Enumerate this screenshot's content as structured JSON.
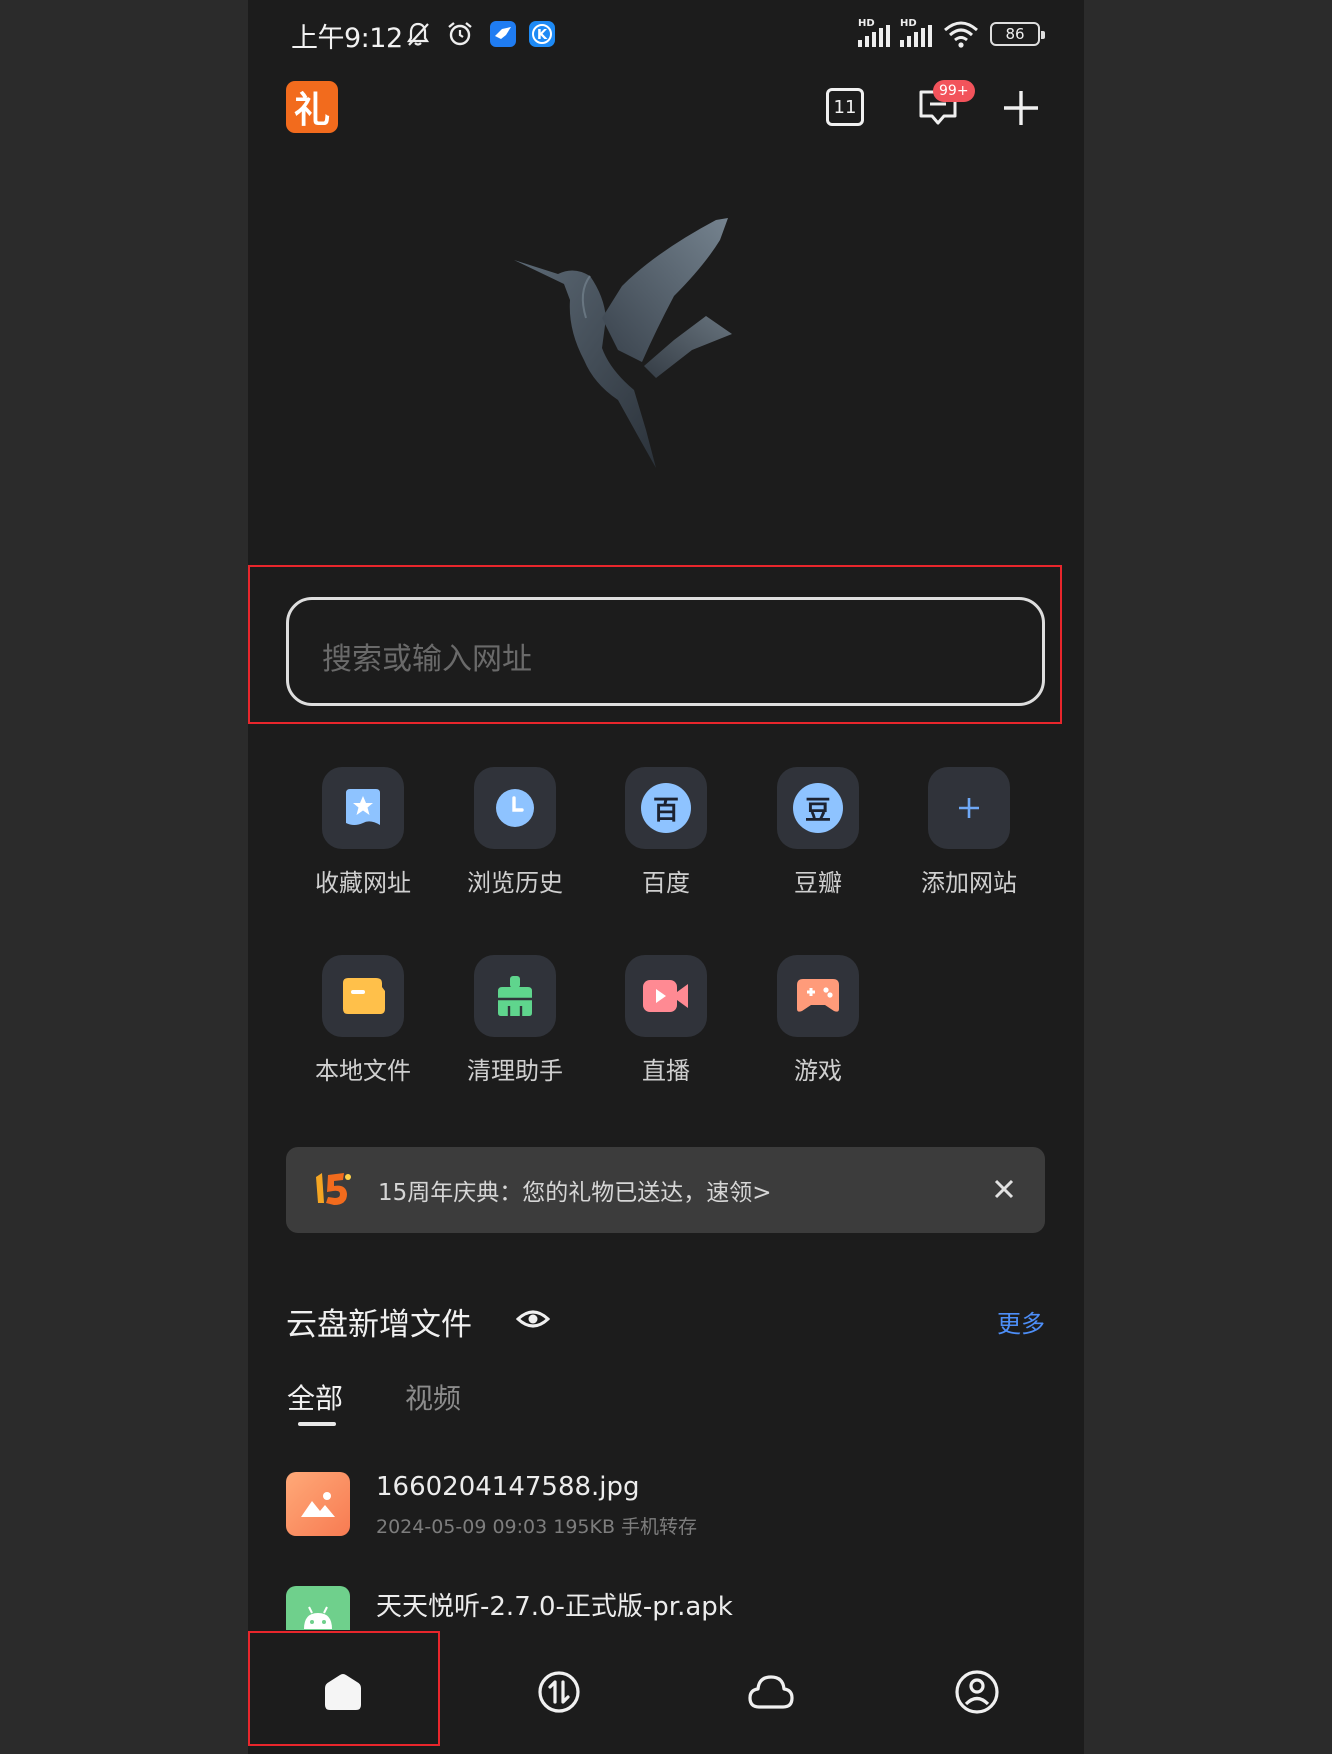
{
  "status_bar": {
    "time": "上午9:12",
    "battery": "86",
    "signal_label_1": "HD",
    "signal_label_2": "HD",
    "icons": [
      "bell-off-icon",
      "alarm-icon",
      "app-notification-icon",
      "k-app-icon",
      "signal-icon",
      "wifi-icon",
      "battery-icon"
    ]
  },
  "top_bar": {
    "logo_text": "礼",
    "tab_count": "11",
    "message_badge": "99+"
  },
  "search": {
    "placeholder": "搜索或输入网址"
  },
  "quick_access": {
    "row1": [
      {
        "label": "收藏网址",
        "icon": "bookmark-star-icon"
      },
      {
        "label": "浏览历史",
        "icon": "history-clock-icon"
      },
      {
        "label": "百度",
        "icon": "baidu-icon",
        "glyph": "百"
      },
      {
        "label": "豆瓣",
        "icon": "douban-icon",
        "glyph": "豆"
      },
      {
        "label": "添加网站",
        "icon": "plus-icon"
      }
    ],
    "row2": [
      {
        "label": "本地文件",
        "icon": "folder-icon"
      },
      {
        "label": "清理助手",
        "icon": "broom-icon"
      },
      {
        "label": "直播",
        "icon": "video-camera-icon"
      },
      {
        "label": "游戏",
        "icon": "gamepad-icon"
      }
    ]
  },
  "promo": {
    "text": "15周年庆典：您的礼物已送达，速领>"
  },
  "cloud_files": {
    "title": "云盘新增文件",
    "more": "更多",
    "tabs": [
      "全部",
      "视频"
    ],
    "files": [
      {
        "name": "1660204147588.jpg",
        "meta": "2024-05-09 09:03  195KB  手机转存",
        "type": "image"
      },
      {
        "name": "天天悦听-2.7.0-正式版-pr.apk",
        "meta": "",
        "type": "apk"
      }
    ]
  },
  "bottom_nav": {
    "items": [
      "home-icon",
      "transfer-icon",
      "cloud-icon",
      "profile-icon"
    ]
  },
  "colors": {
    "background": "#1c1c1c",
    "accent_blue": "#4d8ef7",
    "badge_red": "#f2535b",
    "logo_orange": "#f26b1d",
    "annotation_red": "#e8262c"
  }
}
